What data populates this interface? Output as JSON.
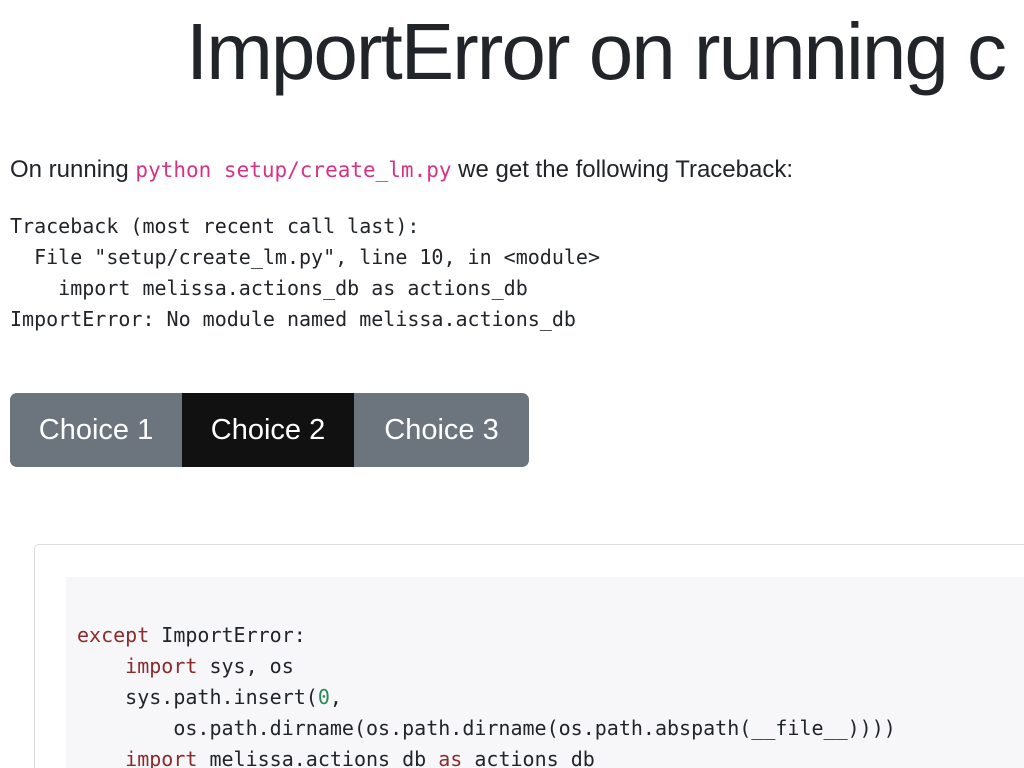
{
  "page": {
    "title": "ImportError on running c"
  },
  "intro": {
    "prefix": "On running ",
    "command": "python setup/create_lm.py",
    "suffix": " we get the following Traceback:"
  },
  "traceback": {
    "lines": [
      "Traceback (most recent call last):",
      "  File \"setup/create_lm.py\", line 10, in <module>",
      "    import melissa.actions_db as actions_db",
      "ImportError: No module named melissa.actions_db"
    ]
  },
  "choices": {
    "items": [
      {
        "label": "Choice 1",
        "active": false
      },
      {
        "label": "Choice 2",
        "active": true
      },
      {
        "label": "Choice 3",
        "active": false
      }
    ]
  },
  "code": {
    "line1_kw": "except",
    "line1_rest": " ImportError:",
    "line2_indent": "    ",
    "line2_kw": "import",
    "line2_rest": " sys, os",
    "line3_a": "    sys.path.insert(",
    "line3_num": "0",
    "line3_b": ",",
    "line4": "        os.path.dirname(os.path.dirname(os.path.abspath(__file__))))",
    "line5_indent": "    ",
    "line5_kw1": "import",
    "line5_mid": " melissa.actions_db ",
    "line5_kw2": "as",
    "line5_rest": " actions_db"
  },
  "colors": {
    "inline_code": "#d63384",
    "choice_default": "#6c757d",
    "choice_active": "#111111",
    "code_keyword": "#8b2c2c",
    "code_number": "#2a8a5b",
    "code_background": "#f7f7f9"
  }
}
